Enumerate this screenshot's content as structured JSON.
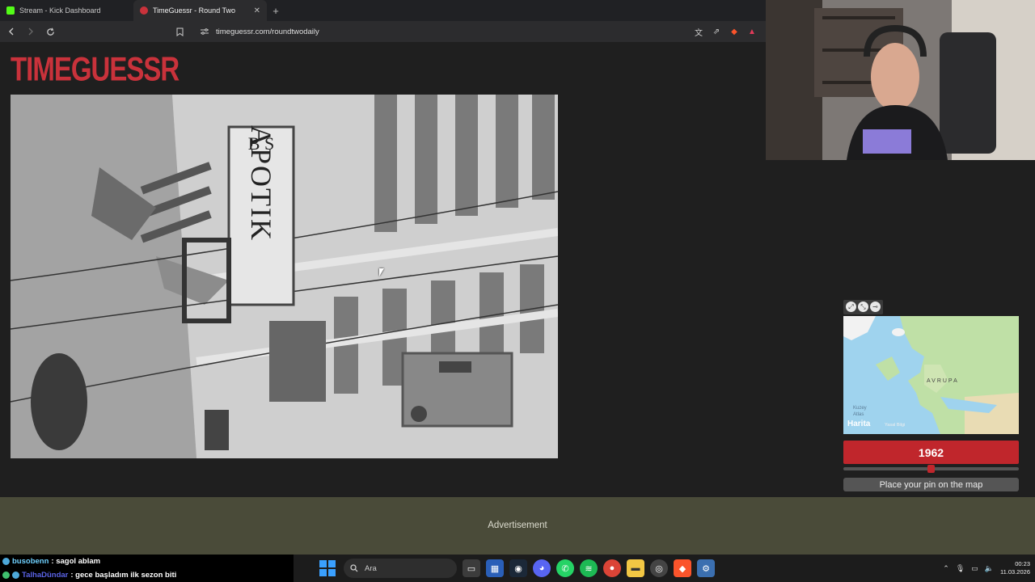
{
  "browser": {
    "tabs": [
      {
        "title": "Stream - Kick Dashboard",
        "favicon_color": "#53fc18"
      },
      {
        "title": "TimeGuessr - Round Two",
        "favicon_color": "#c9323b"
      }
    ],
    "new_tab_label": "+",
    "tab_close_label": "✕",
    "url": "timeguessr.com/roundtwodaily"
  },
  "page": {
    "logo_text": "TIMEGUESSR",
    "year_value": "1962",
    "slider_fraction": 0.5,
    "pin_button_label": "Place your pin on the map",
    "advertisement_label": "Advertisement",
    "map": {
      "region_label": "AVRUPA",
      "ocean_label_line1": "Kuzey",
      "ocean_label_line2": "Atlas",
      "brand": "Harita",
      "legal": "Yasal Bilgi"
    },
    "photo_signs": {
      "pharmacy_top": "B S",
      "pharmacy_text": "APOTIK"
    }
  },
  "chat": [
    {
      "user": "busobenn",
      "message": " : sagol ablam"
    },
    {
      "user": "TalhaDündar",
      "message": " : gece başladım ilk sezon biti"
    }
  ],
  "taskbar": {
    "search_placeholder": "Ara",
    "time": "00:23",
    "date": "11.03.2026"
  },
  "colors": {
    "brand_red": "#c9323b",
    "accent_red": "#c0262c"
  }
}
